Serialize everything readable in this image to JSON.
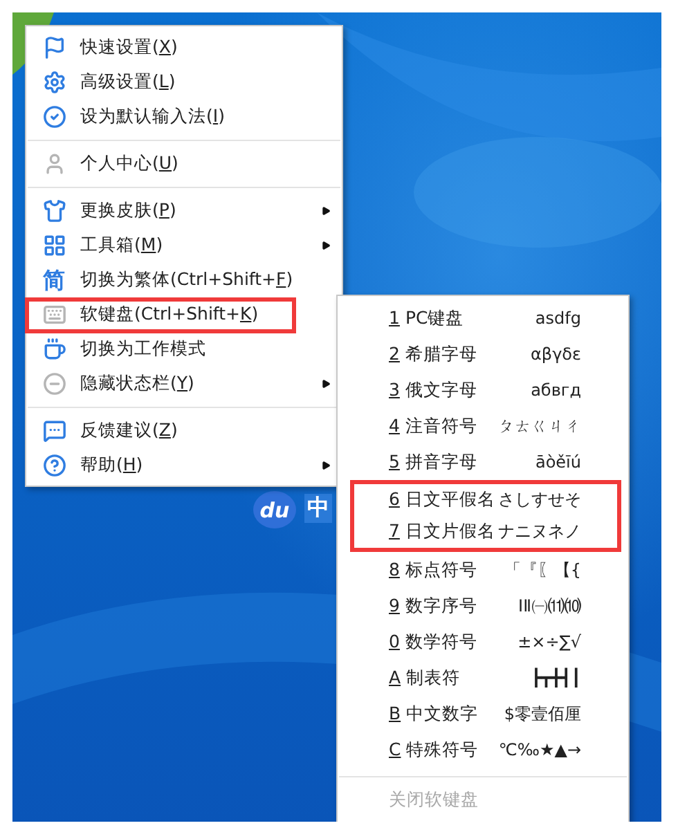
{
  "menu": {
    "items": [
      {
        "kind": "item",
        "text": "快速设置(",
        "accel": "X",
        "after": ")",
        "has_submenu": false,
        "highlighted": false
      },
      {
        "kind": "item",
        "text": "高级设置(",
        "accel": "L",
        "after": ")",
        "has_submenu": false,
        "highlighted": false
      },
      {
        "kind": "item",
        "text": "设为默认输入法(",
        "accel": "I",
        "after": ")",
        "has_submenu": false,
        "highlighted": false
      },
      {
        "kind": "separator"
      },
      {
        "kind": "item",
        "text": "个人中心(",
        "accel": "U",
        "after": ")",
        "has_submenu": false,
        "highlighted": false
      },
      {
        "kind": "separator"
      },
      {
        "kind": "item",
        "text": "更换皮肤(",
        "accel": "P",
        "after": ")",
        "has_submenu": true,
        "highlighted": false
      },
      {
        "kind": "item",
        "text": "工具箱(",
        "accel": "M",
        "after": ")",
        "has_submenu": true,
        "highlighted": false
      },
      {
        "kind": "item",
        "icon_char": "简",
        "text": "切换为繁体(Ctrl+Shift+",
        "accel": "F",
        "after": ")",
        "has_submenu": false,
        "highlighted": false
      },
      {
        "kind": "item",
        "text": "软键盘(Ctrl+Shift+",
        "accel": "K",
        "after": ")",
        "has_submenu": false,
        "highlighted": true
      },
      {
        "kind": "item",
        "text": "切换为工作模式",
        "has_submenu": false,
        "highlighted": false
      },
      {
        "kind": "item",
        "text": "隐藏状态栏(",
        "accel": "Y",
        "after": ")",
        "has_submenu": true,
        "highlighted": false
      },
      {
        "kind": "separator"
      },
      {
        "kind": "item",
        "text": "反馈建议(",
        "accel": "Z",
        "after": ")",
        "has_submenu": false,
        "highlighted": false
      },
      {
        "kind": "item",
        "text": "帮助(",
        "accel": "H",
        "after": ")",
        "has_submenu": true,
        "highlighted": false
      }
    ]
  },
  "keyboard_menu": {
    "items": [
      {
        "accel": "1",
        "label": "PC键盘",
        "sample": "asdfg",
        "highlighted": false
      },
      {
        "accel": "2",
        "label": "希腊字母",
        "sample": "αβγδε",
        "highlighted": false
      },
      {
        "accel": "3",
        "label": "俄文字母",
        "sample": "абвгд",
        "highlighted": false
      },
      {
        "accel": "4",
        "label": "注音符号",
        "sample": "ㄆㄊㄍㄐㄔ",
        "highlighted": false
      },
      {
        "accel": "5",
        "label": "拼音字母",
        "sample": "āòěīú",
        "highlighted": false
      },
      {
        "accel": "6",
        "label": "日文平假名",
        "sample": "さしすせそ",
        "highlighted": true
      },
      {
        "accel": "7",
        "label": "日文片假名",
        "sample": "ナニヌネノ",
        "highlighted": true
      },
      {
        "accel": "8",
        "label": "标点符号",
        "sample": "「『〖【{",
        "highlighted": false
      },
      {
        "accel": "9",
        "label": "数字序号",
        "sample": "ⅠⅡ㈠⑾⑽",
        "highlighted": false
      },
      {
        "accel": "0",
        "label": "数学符号",
        "sample": "±×÷∑√",
        "highlighted": false
      },
      {
        "accel": "A",
        "label": "制表符",
        "sample": "┣┳╋┫┃",
        "highlighted": false
      },
      {
        "accel": "B",
        "label": "中文数字",
        "sample": "$零壹佰厘",
        "highlighted": false
      },
      {
        "accel": "C",
        "label": "特殊符号",
        "sample": "℃‰★▲→",
        "highlighted": false
      }
    ],
    "close": {
      "text": "关闭软键盘",
      "disabled": true
    }
  },
  "status_bar": {
    "logo": "du",
    "mode": "中"
  }
}
